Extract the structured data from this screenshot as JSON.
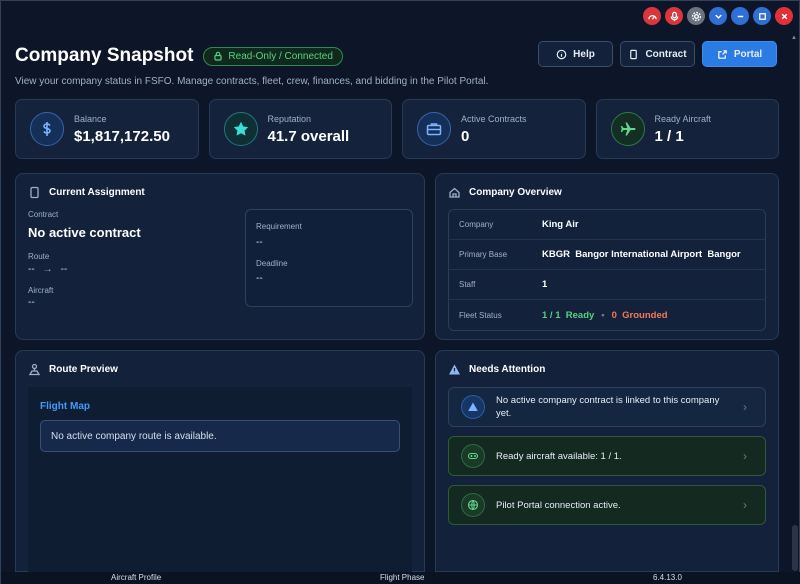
{
  "header": {
    "title": "Company Snapshot",
    "badge": "Read-Only / Connected",
    "subtitle": "View your company status in FSFO. Manage contracts, fleet, crew, finances, and bidding in the Pilot Portal.",
    "buttons": {
      "help": "Help",
      "contract": "Contract",
      "portal": "Portal"
    }
  },
  "stats": [
    {
      "label": "Balance",
      "value": "$1,817,172.50",
      "icon": "dollar-icon"
    },
    {
      "label": "Reputation",
      "value": "41.7 overall",
      "icon": "star-icon"
    },
    {
      "label": "Active Contracts",
      "value": "0",
      "icon": "briefcase-icon"
    },
    {
      "label": "Ready Aircraft",
      "value": "1 / 1",
      "icon": "airplane-icon"
    }
  ],
  "assignment": {
    "title": "Current Assignment",
    "contract_label": "Contract",
    "contract_value": "No active contract",
    "route_label": "Route",
    "route_from": "--",
    "route_arrow": "→",
    "route_to": "--",
    "aircraft_label": "Aircraft",
    "aircraft_value": "--",
    "requirement_label": "Requirement",
    "requirement_value": "--",
    "deadline_label": "Deadline",
    "deadline_value": "--"
  },
  "overview": {
    "title": "Company Overview",
    "rows": [
      {
        "key": "Company",
        "value": "King Air"
      },
      {
        "key": "Primary Base",
        "value": "KBGR  Bangor International Airport  Bangor"
      },
      {
        "key": "Staff",
        "value": "1"
      }
    ],
    "fleet_key": "Fleet Status",
    "fleet_ready": "1 / 1  Ready",
    "fleet_dot": "•",
    "fleet_grounded": "0  Grounded"
  },
  "route_preview": {
    "title": "Route Preview",
    "map_title": "Flight Map",
    "message": "No active company route is available."
  },
  "attention": {
    "title": "Needs Attention",
    "items": [
      {
        "text": "No active company contract is linked to this company yet.",
        "icon": "warning-icon"
      },
      {
        "text": "Ready aircraft available: 1 / 1.",
        "icon": "gamepad-icon"
      },
      {
        "text": "Pilot Portal connection active.",
        "icon": "globe-icon"
      }
    ]
  },
  "statusbar": {
    "left": "Aircraft Profile",
    "center": "Flight Phase",
    "right": "6.4.13.0"
  },
  "colors": {
    "accent": "#2a7be4",
    "ready": "#53d37e",
    "grounded": "#f07a5a",
    "background": "#0c1628"
  }
}
